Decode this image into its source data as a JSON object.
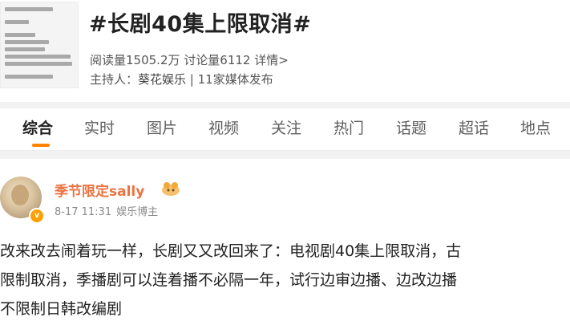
{
  "topic": {
    "title": "#长剧40集上限取消#",
    "read_label": "阅读量1505.2万",
    "discuss_label": "讨论量6112",
    "details_link": "详情>",
    "host_label": "主持人：",
    "host_name": "葵花娱乐",
    "host_sep": " | ",
    "media_count": "11家媒体发布"
  },
  "tabs": [
    {
      "label": "综合",
      "active": true
    },
    {
      "label": "实时"
    },
    {
      "label": "图片"
    },
    {
      "label": "视频"
    },
    {
      "label": "关注"
    },
    {
      "label": "热门"
    },
    {
      "label": "话题"
    },
    {
      "label": "超话"
    },
    {
      "label": "地点"
    }
  ],
  "post": {
    "username": "季节限定sally",
    "timestamp": "8-17 11:31",
    "role": "娱乐博主",
    "lines": [
      "改来改去闹着玩一样，长剧又又改回来了：电视剧40集上限取消，古",
      "限制取消，季播剧可以连着播不必隔一年，试行边审边播、边改边播",
      "不限制日韩改编剧"
    ]
  },
  "colors": {
    "accent": "#ff8200",
    "username": "#eb7340"
  }
}
